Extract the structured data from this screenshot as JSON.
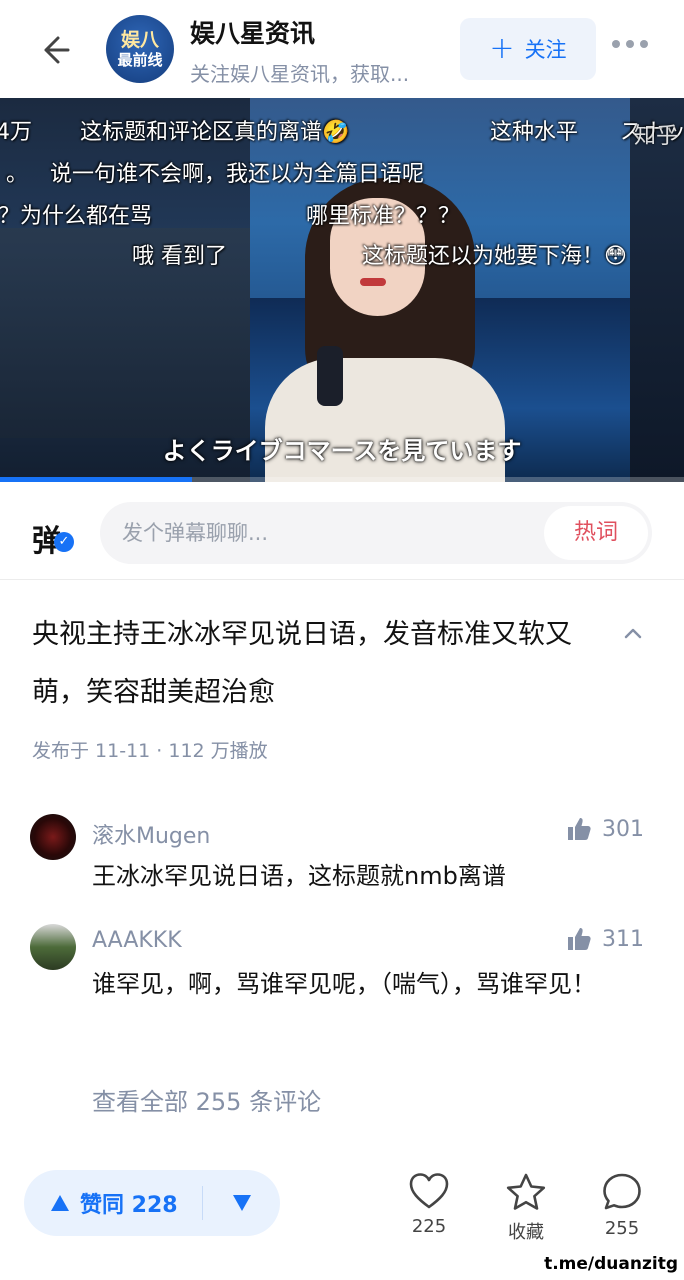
{
  "header": {
    "account_avatar_line1": "娱八",
    "account_avatar_line2": "最前线",
    "account_name": "娱八星资讯",
    "account_subtitle": "关注娱八星资讯，获取...",
    "follow_label": "关注"
  },
  "video": {
    "caption": "よくライブコマースを見ています",
    "watermark": "知乎",
    "progress_fraction": 0.28,
    "danmaku": [
      "4万",
      "这标题和评论区真的离谱🤣",
      "这种水平",
      "スナッ",
      "。",
      "说一句谁不会啊，我还以为全篇日语呢",
      "？为什么都在骂",
      "哪里标准？？？",
      "哦 看到了",
      "这标题还以为她要下海！😳"
    ]
  },
  "danmaku_bar": {
    "icon_label": "弹",
    "input_placeholder": "发个弹幕聊聊...",
    "hot_words_label": "热词"
  },
  "post": {
    "title": "央视主持王冰冰罕见说日语，发音标准又软又萌，笑容甜美超治愈",
    "meta": "发布于 11-11 · 112 万播放"
  },
  "comments": [
    {
      "author": "滚水Mugen",
      "likes": "301",
      "text": "王冰冰罕见说日语，这标题就nmb离谱"
    },
    {
      "author": "AAAKKK",
      "likes": "311",
      "text": "谁罕见，啊，骂谁罕见呢，（喘气），骂谁罕见！"
    }
  ],
  "view_all_comments": "查看全部 255 条评论",
  "bottom_bar": {
    "upvote_label": "赞同 228",
    "like_count": "225",
    "favorite_label": "收藏",
    "comment_count": "255"
  },
  "footer_watermark": "t.me/duanzitg",
  "colors": {
    "accent": "#1772f6",
    "hot": "#e0505e",
    "muted": "#8590a6"
  }
}
